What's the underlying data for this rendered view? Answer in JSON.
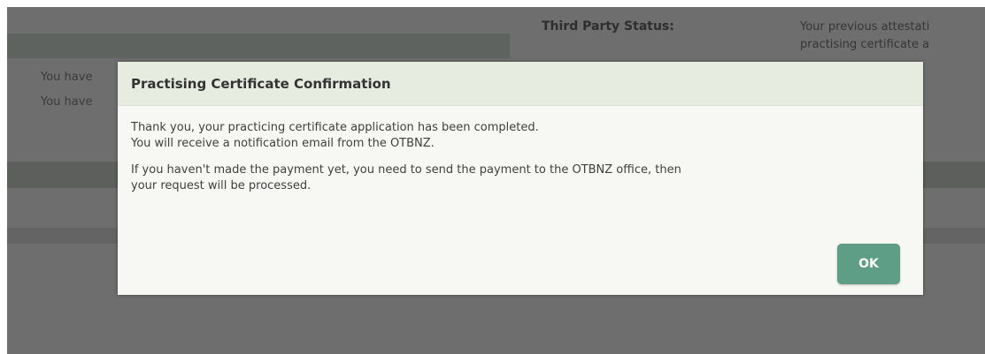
{
  "background": {
    "third_party_status_label": "Third Party Status:",
    "third_party_status_value_line1": "Your previous attestati",
    "third_party_status_value_line2": "practising certificate a",
    "left_text_line1": "You have",
    "left_text_line2": "You have"
  },
  "modal": {
    "title": "Practising Certificate Confirmation",
    "body_line1": "Thank you, your practicing certificate application has been completed.",
    "body_line2": "You will receive a notification email from the OTBNZ.",
    "body_line3": "If you haven't made the payment yet, you need to send the payment to the OTBNZ office, then",
    "body_line4": "your request will be processed.",
    "ok_label": "OK"
  },
  "colors": {
    "overlay": "#6e6e6e",
    "modal_background": "#f7f8f3",
    "modal_header": "#e6ede0",
    "ok_button": "#5f9e86"
  }
}
